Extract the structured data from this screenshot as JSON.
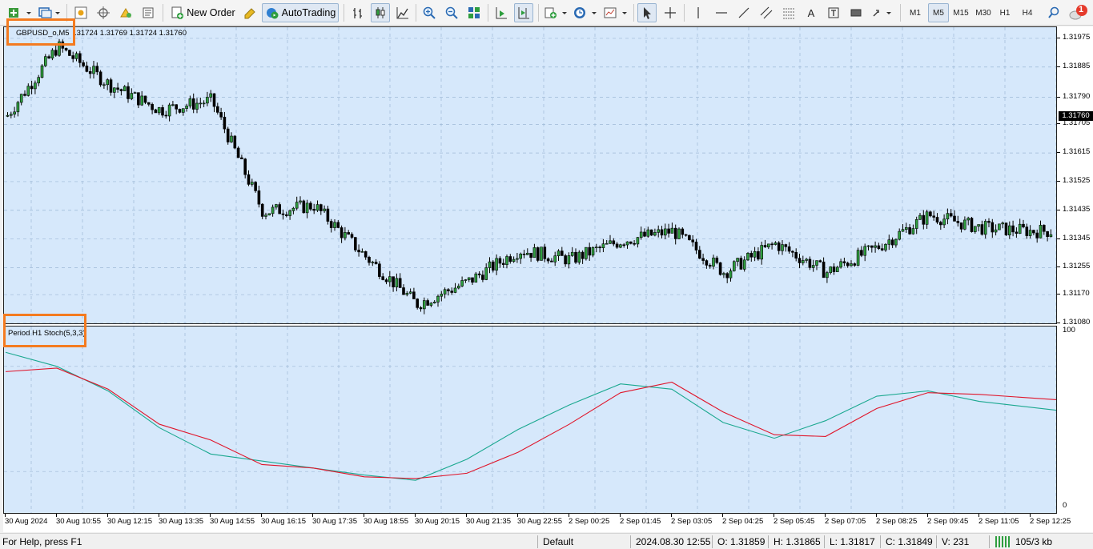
{
  "toolbar": {
    "new_order_label": "New Order",
    "autotrading_label": "AutoTrading",
    "timeframes": [
      "M1",
      "M5",
      "M15",
      "M30",
      "H1",
      "H4"
    ],
    "active_timeframe": "M5",
    "notification_count": "1"
  },
  "chart": {
    "symbol_label": "GBPUSD_o,M5",
    "ohlc_text": ".31724 1.31769 1.31724 1.31760",
    "current_price": "1.31760",
    "indicator_label": "Period H1 Stoch(5,3,3)",
    "price_ticks": [
      "1.31975",
      "1.31885",
      "1.31790",
      "1.31705",
      "1.31615",
      "1.31525",
      "1.31435",
      "1.31345",
      "1.31255",
      "1.31170",
      "1.31080"
    ],
    "indicator_ticks": [
      "100",
      "0"
    ],
    "time_ticks": [
      "30 Aug 2024",
      "30 Aug 10:55",
      "30 Aug 12:15",
      "30 Aug 13:35",
      "30 Aug 14:55",
      "30 Aug 16:15",
      "30 Aug 17:35",
      "30 Aug 18:55",
      "30 Aug 20:15",
      "30 Aug 21:35",
      "30 Aug 22:55",
      "2 Sep 00:25",
      "2 Sep 01:45",
      "2 Sep 03:05",
      "2 Sep 04:25",
      "2 Sep 05:45",
      "2 Sep 07:05",
      "2 Sep 08:25",
      "2 Sep 09:45",
      "2 Sep 11:05",
      "2 Sep 12:25"
    ],
    "colors": {
      "background": "#d6e8fb",
      "candle": "#000000",
      "main_line": "#1aa88f",
      "signal_line": "#e0162b",
      "highlight": "#f47b20"
    }
  },
  "chart_data": {
    "type": "line",
    "title": "",
    "xlabel": "",
    "ylabel": "",
    "x": [
      "30 Aug 2024",
      "30 Aug 10:55",
      "30 Aug 12:15",
      "30 Aug 13:35",
      "30 Aug 14:55",
      "30 Aug 16:15",
      "30 Aug 17:35",
      "30 Aug 18:55",
      "30 Aug 20:15",
      "30 Aug 21:35",
      "30 Aug 22:55",
      "2 Sep 00:25",
      "2 Sep 01:45",
      "2 Sep 03:05",
      "2 Sep 04:25",
      "2 Sep 05:45",
      "2 Sep 07:05",
      "2 Sep 08:25",
      "2 Sep 09:45",
      "2 Sep 11:05",
      "2 Sep 12:25"
    ],
    "price_close": [
      1.3173,
      1.3195,
      1.3183,
      1.3175,
      1.3178,
      1.3143,
      1.3145,
      1.3129,
      1.3114,
      1.3121,
      1.3131,
      1.3128,
      1.3134,
      1.3137,
      1.3124,
      1.3133,
      1.3124,
      1.3132,
      1.3142,
      1.3138,
      1.3137
    ],
    "ylim": [
      1.3108,
      1.3201
    ],
    "series": [
      {
        "values": [
          88,
          80,
          66,
          45,
          30,
          26,
          22,
          18,
          15,
          27,
          44,
          58,
          70,
          67,
          48,
          39,
          49,
          63,
          66,
          60,
          55
        ]
      },
      {
        "values": [
          77,
          79,
          67,
          47,
          38,
          24,
          22,
          17,
          16,
          19,
          31,
          47,
          65,
          71,
          54,
          41,
          40,
          56,
          65,
          64,
          61
        ]
      }
    ],
    "indicator_ylim": [
      0,
      100
    ],
    "grid": true
  },
  "status": {
    "help": "For Help, press F1",
    "profile": "Default",
    "datetime": "2024.08.30 12:55",
    "open": "O: 1.31859",
    "high": "H: 1.31865",
    "low": "L: 1.31817",
    "close": "C: 1.31849",
    "volume": "V: 231",
    "traffic": "105/3 kb"
  }
}
